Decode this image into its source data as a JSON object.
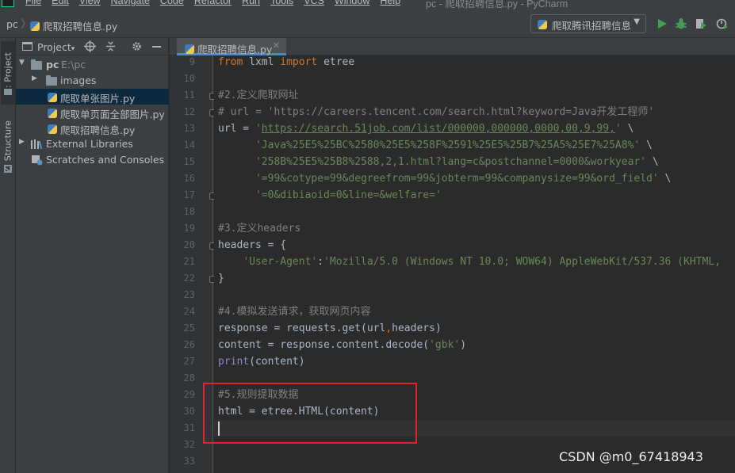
{
  "menubar": {
    "items": [
      "File",
      "Edit",
      "View",
      "Navigate",
      "Code",
      "Refactor",
      "Run",
      "Tools",
      "VCS",
      "Window",
      "Help"
    ],
    "window_title": "pc - 爬取招聘信息.py - PyCharm"
  },
  "navbar": {
    "project": "pc",
    "file": "爬取招聘信息.py",
    "run_config": "爬取腾讯招聘信息",
    "icons": [
      "run-icon",
      "debug-icon",
      "coverage-icon",
      "profile-icon",
      "concurrency-icon"
    ]
  },
  "toolstrip": {
    "project_tab": "1: Project",
    "structure_tab": "Z: Structure"
  },
  "project_panel": {
    "title": "Project",
    "tree": [
      {
        "label": "pc",
        "path": "E:\\pc",
        "type": "folder",
        "expanded": true
      },
      {
        "label": "images",
        "type": "folder",
        "expanded": false
      },
      {
        "label": "爬取单张图片.py",
        "type": "python-file",
        "selected": true
      },
      {
        "label": "爬取单页面全部图片.py",
        "type": "python-file"
      },
      {
        "label": "爬取招聘信息.py",
        "type": "python-file"
      },
      {
        "label": "External Libraries",
        "type": "library"
      },
      {
        "label": "Scratches and Consoles",
        "type": "scratches"
      }
    ]
  },
  "editor": {
    "tab_label": "爬取招聘信息.py",
    "caret_line": 31,
    "lines": [
      {
        "n": "9",
        "text": "from lxml import etree"
      },
      {
        "n": "10",
        "text": ""
      },
      {
        "n": "11",
        "text": "#2.定义爬取网址"
      },
      {
        "n": "12",
        "text": "# url = 'https://careers.tencent.com/search.html?keyword=Java开发工程师'"
      },
      {
        "n": "13",
        "text": "url = 'https://search.51job.com/list/000000,000000,0000,00,9,99,' \\"
      },
      {
        "n": "14",
        "text": "      'Java%25E5%25BC%2580%25E5%258F%2591%25E5%25B7%25A5%25E7%25A8%' \\"
      },
      {
        "n": "15",
        "text": "      '258B%25E5%25B8%2588,2,1.html?lang=c&postchannel=0000&workyear' \\"
      },
      {
        "n": "16",
        "text": "      '=99&cotype=99&degreefrom=99&jobterm=99&companysize=99&ord_field' \\"
      },
      {
        "n": "17",
        "text": "      '=0&dibiaoid=0&line=&welfare='"
      },
      {
        "n": "18",
        "text": ""
      },
      {
        "n": "19",
        "text": "#3.定义headers"
      },
      {
        "n": "20",
        "text": "headers = {"
      },
      {
        "n": "21",
        "text": "    'User-Agent':'Mozilla/5.0 (Windows NT 10.0; WOW64) AppleWebKit/537.36 (KHTML,"
      },
      {
        "n": "22",
        "text": "}"
      },
      {
        "n": "23",
        "text": ""
      },
      {
        "n": "24",
        "text": "#4.模拟发送请求，获取网页内容"
      },
      {
        "n": "25",
        "text": "response = requests.get(url,headers)"
      },
      {
        "n": "26",
        "text": "content = response.content.decode('gbk')"
      },
      {
        "n": "27",
        "text": "print(content)"
      },
      {
        "n": "28",
        "text": ""
      },
      {
        "n": "29",
        "text": "#5.规则提取数据"
      },
      {
        "n": "30",
        "text": "html = etree.HTML(content)"
      },
      {
        "n": "31",
        "text": ""
      },
      {
        "n": "32",
        "text": ""
      },
      {
        "n": "33",
        "text": ""
      }
    ]
  },
  "watermark": "CSDN @m0_67418943",
  "colors": {
    "editor_bg": "#2b2b2b",
    "panel_bg": "#3c3f41",
    "keyword": "#cc7832",
    "string": "#6a8759",
    "comment": "#808080",
    "highlight_box": "#e0242b"
  }
}
